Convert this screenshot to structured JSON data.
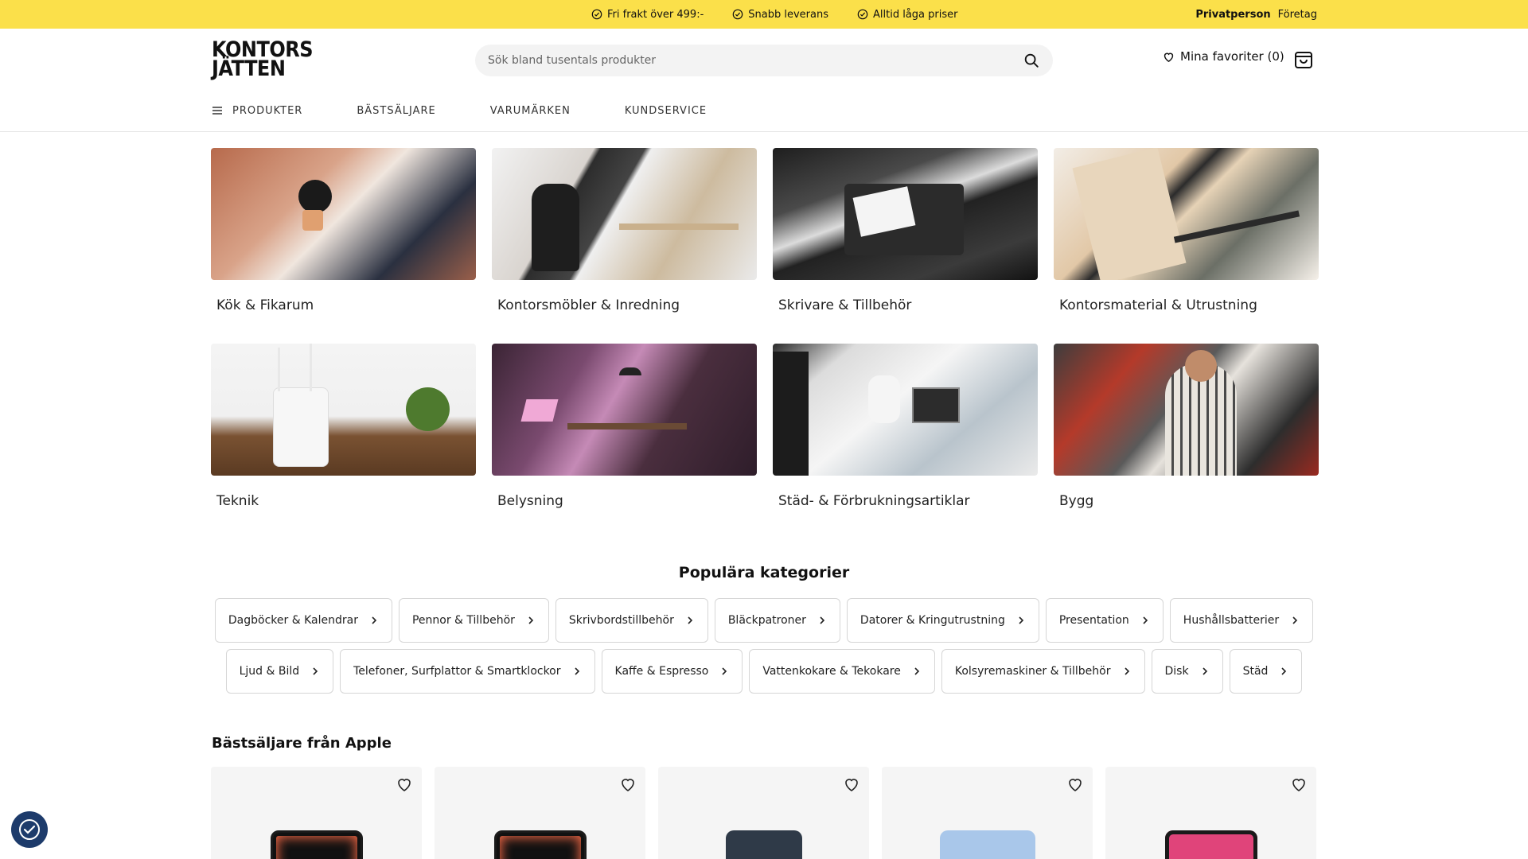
{
  "topbar": {
    "usps": [
      "Fri frakt över 499:-",
      "Snabb leverans",
      "Alltid låga priser"
    ],
    "audience_active": "Privatperson",
    "audience_other": "Företag"
  },
  "header": {
    "logo_line1": "KONTORS",
    "logo_line2": "JÄTTEN",
    "search_placeholder": "Sök bland tusentals produkter",
    "favorites_label": "Mina favoriter (0)"
  },
  "nav": {
    "items": [
      "PRODUKTER",
      "BÄSTSÄLJARE",
      "VARUMÄRKEN",
      "KUNDSERVICE"
    ]
  },
  "categories": [
    {
      "label": "Kök & Fikarum",
      "image": "kitchen-coffee-photo"
    },
    {
      "label": "Kontorsmöbler & Inredning",
      "image": "office-furniture-photo"
    },
    {
      "label": "Skrivare & Tillbehör",
      "image": "printer-photo"
    },
    {
      "label": "Kontorsmaterial & Utrustning",
      "image": "office-supplies-photo"
    },
    {
      "label": "Teknik",
      "image": "router-photo"
    },
    {
      "label": "Belysning",
      "image": "lighting-photo"
    },
    {
      "label": "Städ- & Förbrukningsartiklar",
      "image": "cleaning-photo"
    },
    {
      "label": "Bygg",
      "image": "tools-photo"
    }
  ],
  "popular": {
    "title": "Populära kategorier",
    "row1": [
      "Dagböcker & Kalendrar",
      "Pennor & Tillbehör",
      "Skrivbordstillbehör",
      "Bläckpatroner",
      "Datorer & Kringutrustning",
      "Presentation",
      "Hushållsbatterier"
    ],
    "row2": [
      "Ljud & Bild",
      "Telefoner, Surfplattor & Smartklockor",
      "Kaffe & Espresso",
      "Vattenkokare & Tekokare",
      "Kolsyremaskiner & Tillbehör",
      "Disk",
      "Städ"
    ]
  },
  "bestsellers": {
    "title": "Bästsäljare från Apple",
    "products": [
      "ipad-pro",
      "ipad-pro",
      "iphone",
      "ipad-air",
      "ipad-mini"
    ]
  },
  "colors": {
    "topbar": "#fbe04a",
    "accessibility_button": "#1d3b6b"
  }
}
